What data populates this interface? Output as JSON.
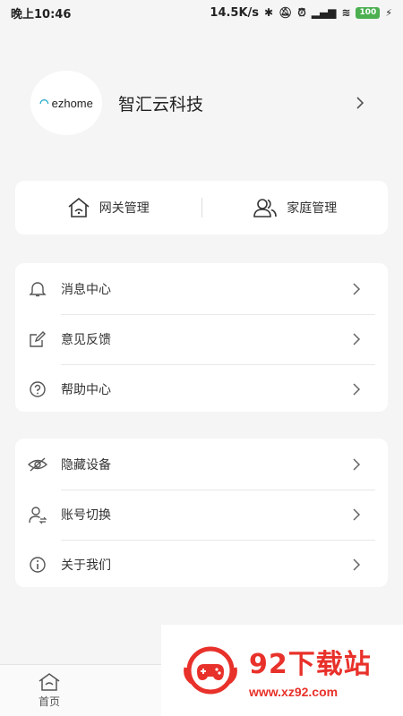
{
  "status": {
    "time": "晚上10:46",
    "speed": "14.5K/s",
    "battery": "100"
  },
  "profile": {
    "avatar_text": "ezhome",
    "name": "智汇云科技"
  },
  "quick": {
    "gateway": "网关管理",
    "family": "家庭管理"
  },
  "menu1": [
    {
      "label": "消息中心",
      "icon": "bell-icon"
    },
    {
      "label": "意见反馈",
      "icon": "edit-icon"
    },
    {
      "label": "帮助中心",
      "icon": "help-icon"
    }
  ],
  "menu2": [
    {
      "label": "隐藏设备",
      "icon": "eye-hidden-icon"
    },
    {
      "label": "账号切换",
      "icon": "user-switch-icon"
    },
    {
      "label": "关于我们",
      "icon": "info-icon"
    }
  ],
  "tabbar": {
    "home": "首页"
  },
  "watermark": {
    "title": "92下载站",
    "url": "www.xz92.com"
  },
  "colors": {
    "background": "#f5f5f5",
    "card": "#ffffff",
    "watermark_red": "#e8312a",
    "logo_teal": "#1ba7c8"
  }
}
